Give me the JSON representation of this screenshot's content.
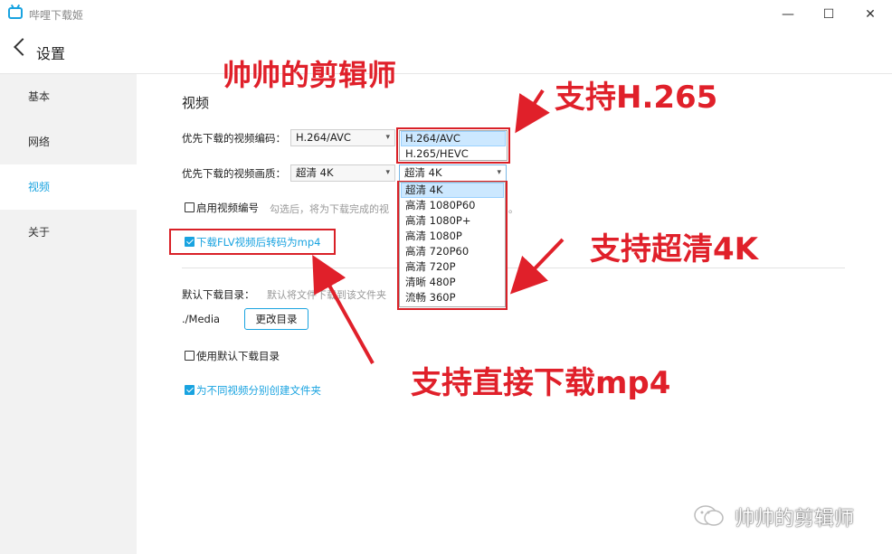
{
  "window": {
    "app_title": "哔哩下载姬",
    "minimize": "—",
    "maximize": "☐",
    "close": "✕"
  },
  "header": {
    "title": "设置"
  },
  "sidebar": {
    "items": [
      {
        "label": "基本",
        "active": false
      },
      {
        "label": "网络",
        "active": false
      },
      {
        "label": "视频",
        "active": true
      },
      {
        "label": "关于",
        "active": false
      }
    ]
  },
  "video": {
    "section_title": "视频",
    "codec": {
      "label": "优先下载的视频编码：",
      "value": "H.264/AVC",
      "options": [
        "H.264/AVC",
        "H.265/HEVC"
      ],
      "selected_option": "H.264/AVC"
    },
    "quality": {
      "label": "优先下载的视频画质：",
      "value": "超清 4K",
      "options": [
        "超清 4K",
        "高清 1080P60",
        "高清 1080P+",
        "高清 1080P",
        "高清 720P60",
        "高清 720P",
        "清晰 480P",
        "流畅 360P"
      ],
      "selected_option": "超清 4K"
    },
    "numbering": {
      "label": "启用视频编号",
      "checked": false,
      "hint": "勾选后，将为下载完成的视"
    },
    "transcode": {
      "label": "下载FLV视频后转码为mp4",
      "checked": true
    },
    "directory": {
      "label": "默认下载目录：",
      "hint": "默认将文件下载到该文件夹",
      "path": "./Media",
      "change_button": "更改目录"
    },
    "use_default_dir": {
      "label": "使用默认下载目录",
      "checked": false
    },
    "create_folder": {
      "label": "为不同视频分别创建文件夹",
      "checked": true
    }
  },
  "annotations": {
    "top_title": "帅帅的剪辑师",
    "h265": "支持H.265",
    "uhd4k": "支持超清4K",
    "mp4": "支持直接下载mp4",
    "watermark": "帅帅的剪辑师",
    "color": "#e0202a"
  },
  "colors": {
    "accent": "#19a3e0",
    "sidebar_bg": "#f2f2f2",
    "annotation_red": "#e0202a"
  }
}
